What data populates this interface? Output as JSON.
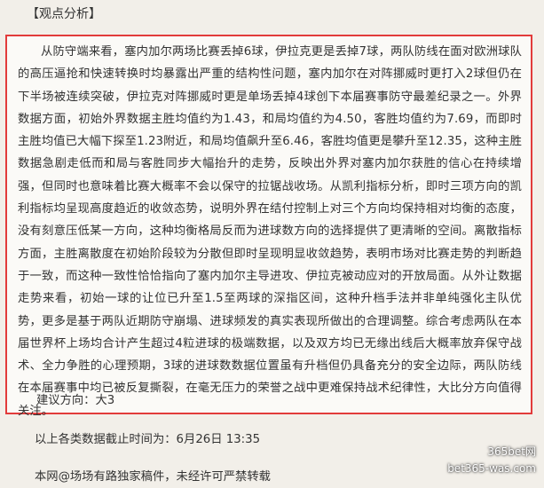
{
  "header": {
    "section_title": "【观点分析】"
  },
  "analysis": {
    "text": "从防守端来看，塞内加尔两场比赛丢掉6球，伊拉克更是丢掉7球，两队防线在面对欧洲球队的高压逼抢和快速转换时均暴露出严重的结构性问题，塞内加尔在对阵挪威时更打入2球但仍在下半场被连续突破，伊拉克对阵挪威时更是单场丢掉4球创下本届赛事防守最差纪录之一。外界数据方面，初始外界数据主胜均值约为1.43，和局均值约为4.50，客胜均值约为7.69，而即时主胜均值已大幅下探至1.23附近，和局均值飙升至6.46，客胜均值更是攀升至12.35，这种主胜数据急剧走低而和局与客胜同步大幅抬升的走势，反映出外界对塞内加尔获胜的信心在持续增强，但同时也意味着比赛大概率不会以保守的拉锯战收场。从凯利指标分析，即时三项方向的凯利指标均呈现高度趋近的收敛态势，说明外界在结付控制上对三个方向均保持相对均衡的态度，没有刻意压低某一方向，这种均衡格局反而为进球数方向的选择提供了更清晰的空间。离散指标方面，主胜离散度在初始阶段较为分散但即时呈现明显收敛趋势，表明市场对比赛走势的判断趋于一致，而这种一致性恰恰指向了塞内加尔主导进攻、伊拉克被动应对的开放局面。从外让数据走势来看，初始一球的让位已升至1.5至两球的深指区间，这种升档手法并非单纯强化主队优势，更多是基于两队近期防守崩塌、进球频发的真实表现所做出的合理调整。综合考虑两队在本届世界杯上场均合计产生超过4粒进球的极端数据，以及双方均已无缘出线后大概率放弃保守战术、全力争胜的心理预期，3球的进球数数据位置虽有升档但仍具备充分的安全边际，两队防线在本届赛事中均已被反复撕裂，在毫无压力的荣誉之战中更难保持战术纪律性，大比分方向值得关注。"
  },
  "advice": "建议方向：大3",
  "deadline": "以上各类数据截止时间为：6月26日 13:35",
  "copyright": "本网@场场有路独家稿件，未经许可严禁转载",
  "watermark": {
    "line1": "365bet网",
    "line2": "bet365-was.com"
  },
  "colors": {
    "border": "#e23b3b",
    "background": "#f2efe9",
    "panel": "#fbfaf7",
    "text": "#333333"
  }
}
